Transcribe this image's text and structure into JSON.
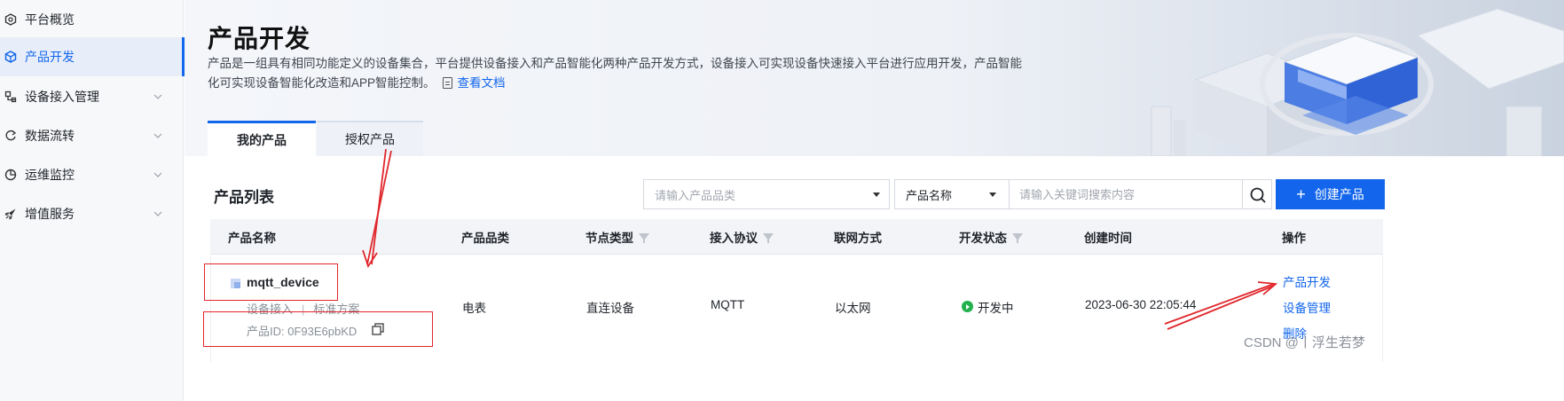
{
  "sidebar": {
    "items": [
      {
        "label": "平台概览",
        "icon": "overview-icon",
        "active": false,
        "has_chevron": false
      },
      {
        "label": "产品开发",
        "icon": "cube-icon",
        "active": true,
        "has_chevron": false
      },
      {
        "label": "设备接入管理",
        "icon": "device-access-icon",
        "active": false,
        "has_chevron": true
      },
      {
        "label": "数据流转",
        "icon": "data-flow-icon",
        "active": false,
        "has_chevron": true
      },
      {
        "label": "运维监控",
        "icon": "monitor-icon",
        "active": false,
        "has_chevron": true
      },
      {
        "label": "增值服务",
        "icon": "rocket-icon",
        "active": false,
        "has_chevron": true
      }
    ]
  },
  "banner": {
    "title": "产品开发",
    "description_line1": "产品是一组具有相同功能定义的设备集合，平台提供设备接入和产品智能化两种产品开发方式，设备接入可实现设备快速接入平台进行应用开发，产品智能",
    "description_line2": "化可实现设备智能化改造和APP智能控制。",
    "doc_link": "查看文档"
  },
  "tabs": [
    {
      "label": "我的产品",
      "active": true
    },
    {
      "label": "授权产品",
      "active": false
    }
  ],
  "list": {
    "title": "产品列表",
    "category_placeholder": "请输入产品品类",
    "field_select": "产品名称",
    "keyword_placeholder": "请输入关键词搜索内容",
    "create_button": "创建产品"
  },
  "table": {
    "columns": [
      "产品名称",
      "产品品类",
      "节点类型",
      "接入协议",
      "联网方式",
      "开发状态",
      "创建时间",
      "操作"
    ],
    "rows": [
      {
        "name": "mqtt_device",
        "tag1": "设备接入",
        "tag_sep": "|",
        "tag2": "标准方案",
        "product_id": "产品ID:  0F93E6pbKD",
        "category": "电表",
        "node_type": "直连设备",
        "protocol": "MQTT",
        "network": "以太网",
        "status": "开发中",
        "created": "2023-06-30 22:05:44",
        "actions": [
          "产品开发",
          "设备管理",
          "删除"
        ]
      }
    ]
  },
  "colors": {
    "primary": "#1366ec",
    "annotation": "#e0262b",
    "status_dev": "#22b14c"
  },
  "watermark": "CSDN @丨浮生若梦"
}
